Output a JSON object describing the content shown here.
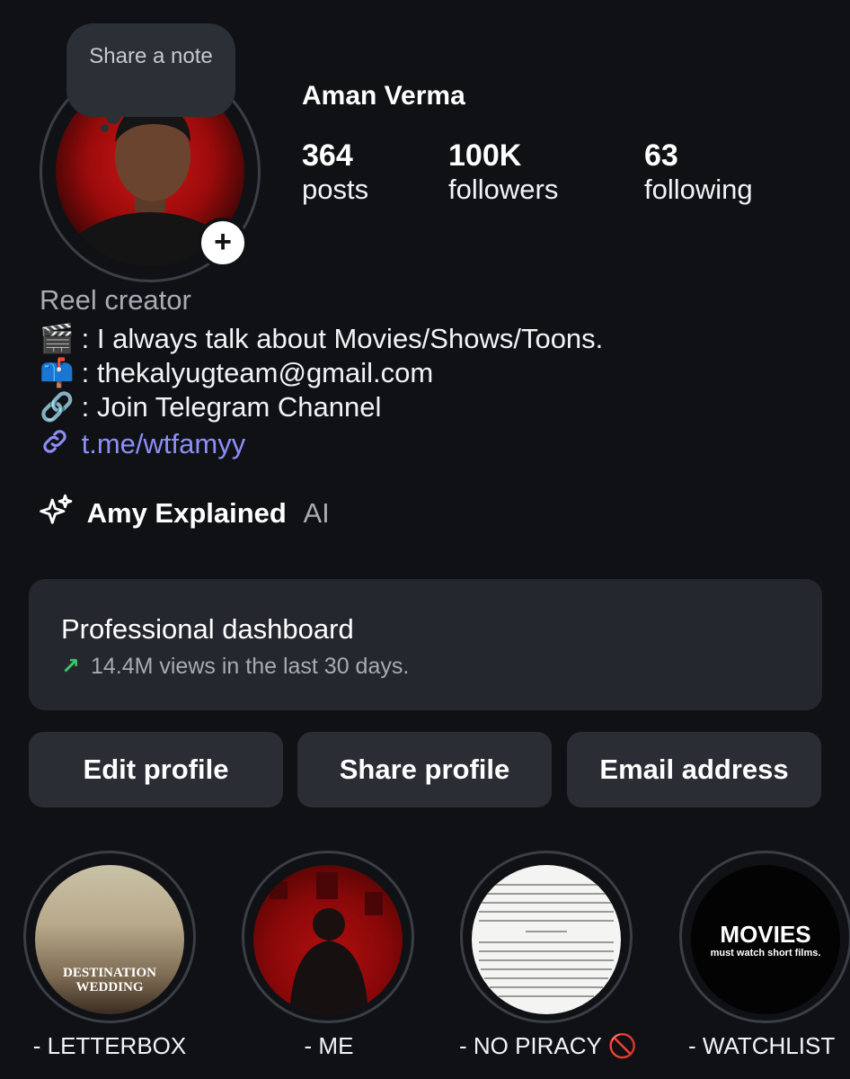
{
  "note": {
    "text": "Share a note"
  },
  "profile": {
    "name": "Aman Verma",
    "stats": [
      {
        "value": "364",
        "label": "posts"
      },
      {
        "value": "100K",
        "label": "followers"
      },
      {
        "value": "63",
        "label": "following"
      }
    ],
    "category": "Reel creator",
    "bio_lines": [
      {
        "emoji": "🎬",
        "text": ": I always talk about Movies/Shows/Toons."
      },
      {
        "emoji": "📫",
        "text": ": thekalyugteam@gmail.com"
      },
      {
        "emoji": "🔗",
        "text": ": Join Telegram Channel"
      }
    ],
    "link": "t.me/wtfamyy",
    "ai": {
      "name": "Amy Explained",
      "tag": "AI"
    }
  },
  "dashboard": {
    "title": "Professional dashboard",
    "subtitle": "14.4M views in the last 30 days."
  },
  "buttons": {
    "edit": "Edit profile",
    "share": "Share profile",
    "email": "Email address"
  },
  "highlights": [
    {
      "label": "- LETTERBOX",
      "cover_text": "DESTINATION WEDDING"
    },
    {
      "label": "- ME"
    },
    {
      "label": "- NO PIRACY 🚫"
    },
    {
      "label": "- WATCHLIST",
      "cover_title": "MOVIES",
      "cover_subtitle": "must watch short films."
    }
  ],
  "colors": {
    "background": "#0f1115",
    "card": "#24272d",
    "button": "#2a2d34",
    "link": "#8d8ef7",
    "trend": "#3ac46b"
  }
}
